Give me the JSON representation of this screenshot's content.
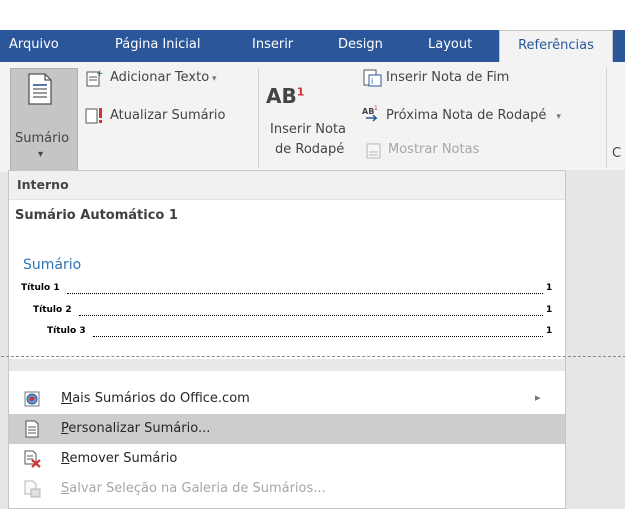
{
  "tabs": [
    {
      "label": "Arquivo"
    },
    {
      "label": "Página Inicial"
    },
    {
      "label": "Inserir"
    },
    {
      "label": "Design"
    },
    {
      "label": "Layout"
    },
    {
      "label": "Referências"
    }
  ],
  "ribbon": {
    "sumario_line1": "Sumário",
    "sumario_arrow": "▾",
    "adicionar_texto": "Adicionar Texto",
    "atualizar_sumario": "Atualizar Sumário",
    "ab_icon_text": "AB",
    "ab_superscript": "1",
    "inserir_nota_line1": "Inserir Nota",
    "inserir_nota_line2": "de Rodapé",
    "inserir_nota_fim": "Inserir Nota de Fim",
    "proxima_nota": "Próxima Nota de Rodapé",
    "mostrar_notas": "Mostrar Notas",
    "cut_off_letter": "C",
    "colors": {
      "accent": "#2b579a",
      "red_mark": "#d13438"
    }
  },
  "dropdown": {
    "section_header": "Interno",
    "gallery_title": "Sumário Automático 1",
    "preview_heading": "Sumário",
    "preview_entries": [
      {
        "text": "Título 1",
        "page": "1"
      },
      {
        "text": "Título 2",
        "page": "1"
      },
      {
        "text": "Título 3",
        "page": "1"
      }
    ],
    "menu": [
      {
        "prefix": "M",
        "rest": "ais Sumários do Office.com",
        "has_arrow": true,
        "icon": "office-globe-icon"
      },
      {
        "prefix": "P",
        "rest": "ersonalizar Sumário...",
        "hover": true,
        "icon": "customize-toc-icon"
      },
      {
        "prefix": "R",
        "rest": "emover Sumário",
        "icon": "remove-toc-icon"
      },
      {
        "prefix": "S",
        "rest": "alvar Seleção na Galeria de Sumários...",
        "disabled": true,
        "icon": "save-selection-icon"
      }
    ],
    "submenu_arrow": "▸"
  }
}
